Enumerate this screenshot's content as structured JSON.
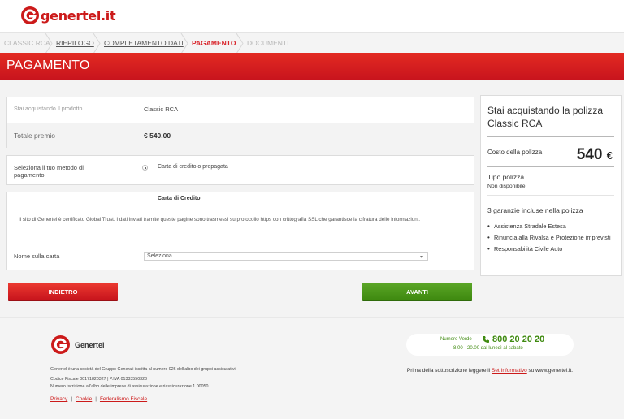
{
  "brand": {
    "name": "genertel.it",
    "footer_name": "Genertel",
    "color": "#cc1a1a"
  },
  "breadcrumb": [
    {
      "label": "CLASSIC RCA",
      "state": "muted"
    },
    {
      "label": "RIEPILOGO",
      "state": "done"
    },
    {
      "label": "COMPLETAMENTO DATI",
      "state": "done"
    },
    {
      "label": "PAGAMENTO",
      "state": "active"
    },
    {
      "label": "DOCUMENTI",
      "state": "muted"
    }
  ],
  "page_title": "PAGAMENTO",
  "summary": {
    "product_label": "Stai acquistando il prodotto",
    "product_value": "Classic RCA",
    "total_label": "Totale premio",
    "total_value": "€ 540,00"
  },
  "payment_method": {
    "label": "Seleziona il tuo metodo di pagamento",
    "option": "Carta di credito o prepagata"
  },
  "card": {
    "title": "Carta di Credito",
    "security_note": "Il sito di Genertel è certificato Global Trust. I dati inviati tramite queste pagine sono trasmessi su protocollo https con crittografia SSL che garantisce la cifratura delle informazioni.",
    "name_label": "Nome sulla carta",
    "name_select": "Seleziona"
  },
  "buttons": {
    "back": "INDIETRO",
    "next": "AVANTI"
  },
  "side": {
    "title": "Stai acquistando la polizza Classic RCA",
    "cost_label": "Costo della polizza",
    "price": "540",
    "currency": "€",
    "type_label": "Tipo polizza",
    "type_value": "Non disponibile",
    "guarantees_title": "3 garanzie incluse nella polizza",
    "guarantees": [
      "Assistenza Stradale Estesa",
      "Rinuncia alla Rivalsa e Protezione imprevisti",
      "Responsabilità Civile Auto"
    ]
  },
  "footer": {
    "line1": "Genertel è una società del Gruppo Generali iscritta al numero 026 dell'albo dei gruppi assicurativi.",
    "line2": "Codice Fiscale 00171820327 | P.IVA 01333550323",
    "line3": "Numero iscrizione all'albo delle imprese di assicurazione e riassicurazione 1.00050",
    "links": [
      "Privacy",
      "Cookie",
      "Federalismo Fiscale"
    ],
    "numero_verde_label": "Numero Verde",
    "phone": "800 20 20 20",
    "hours": "8.00 - 20.00 dal lunedì al sabato",
    "info_before": "Prima della sottoscrizione leggere il",
    "info_link": "Set Informativo",
    "info_after": "su www.genertel.it."
  }
}
